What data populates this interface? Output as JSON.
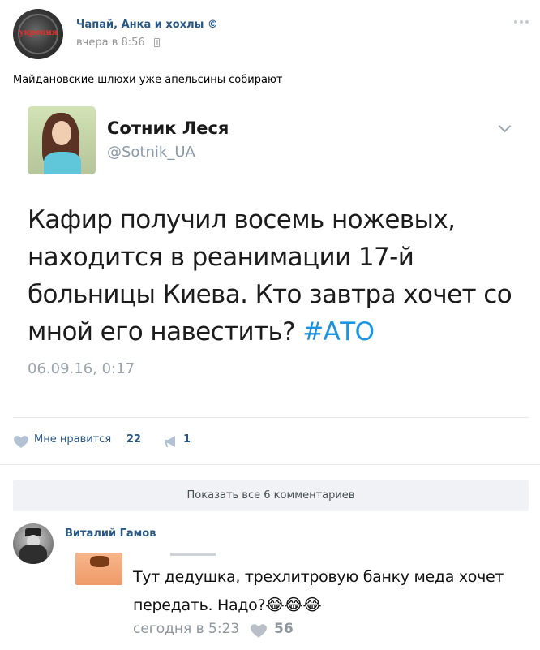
{
  "post": {
    "author": "Чапай, Анка и хохлы ©",
    "time": "вчера в 8:56",
    "avatar_logo": "укропия",
    "text": "Майдановские шлюхи уже апельсины собирают"
  },
  "tweet": {
    "name": "Сотник Леся",
    "handle": "@Sotnik_UA",
    "body_text": "Кафир получил восемь ножевых, находится в реанимации 17-й больницы Киева. Кто завтра хочет со мной его навестить? ",
    "hashtag": "#АТО",
    "date": "06.09.16, 0:17"
  },
  "actions": {
    "like_label": "Мне нравится",
    "like_count": "22",
    "share_count": "1"
  },
  "comments_link": "Показать все 6 комментариев",
  "comment": {
    "author": "Виталий Гамов",
    "text": "Тут дедушка, трехлитровую банку меда хочет передать. Надо?",
    "emoji": "😂😂😂",
    "time": "сегодня в 5:23",
    "likes": "56"
  },
  "colors": {
    "link": "#2a5885",
    "muted": "#939393",
    "hashtag": "#1b95e0",
    "button_bg": "#f0f2f5"
  }
}
